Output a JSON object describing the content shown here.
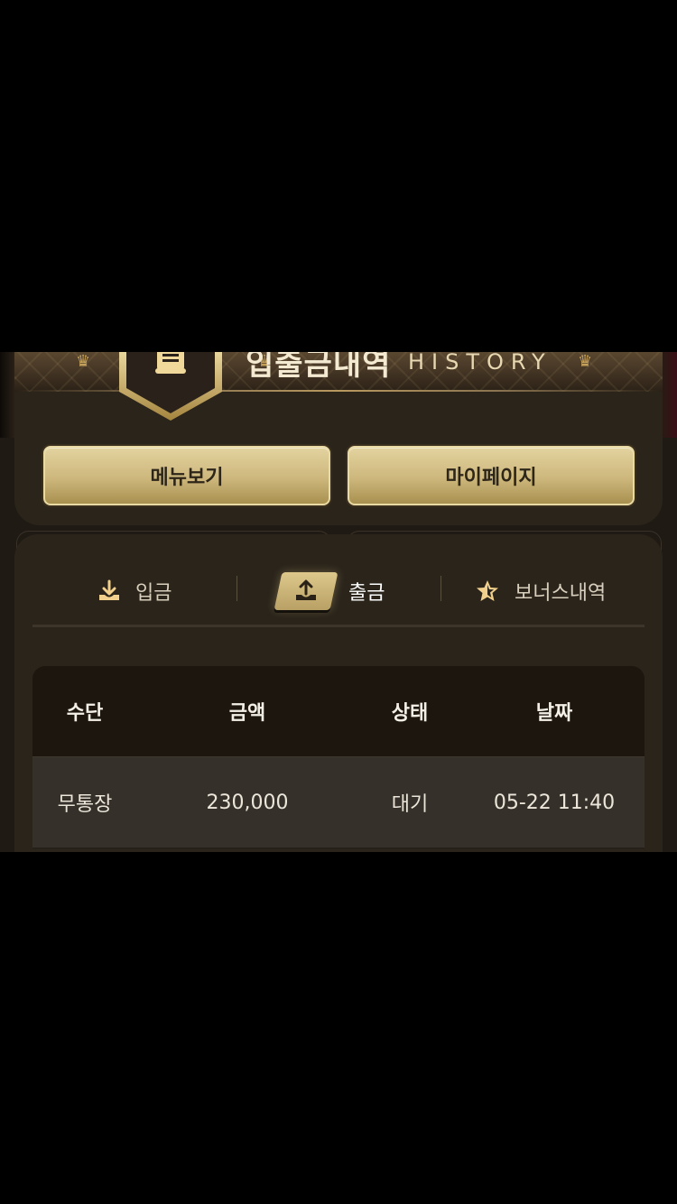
{
  "header": {
    "title": "입출금내역",
    "subtitle": "HISTORY"
  },
  "top_buttons": {
    "menu_label": "메뉴보기",
    "mypage_label": "마이페이지"
  },
  "tabs": [
    {
      "label": "입금",
      "icon": "download-icon",
      "active": false
    },
    {
      "label": "출금",
      "icon": "upload-icon",
      "active": true
    },
    {
      "label": "보너스내역",
      "icon": "star-icon",
      "active": false
    }
  ],
  "table": {
    "columns": [
      "수단",
      "금액",
      "상태",
      "날짜"
    ],
    "rows": [
      {
        "method": "무통장",
        "amount": "230,000",
        "status": "대기",
        "date": "05-22 11:40"
      }
    ]
  },
  "colors": {
    "gold": "#d8c386",
    "background": "#1f1a13",
    "card": "#2a241b"
  }
}
